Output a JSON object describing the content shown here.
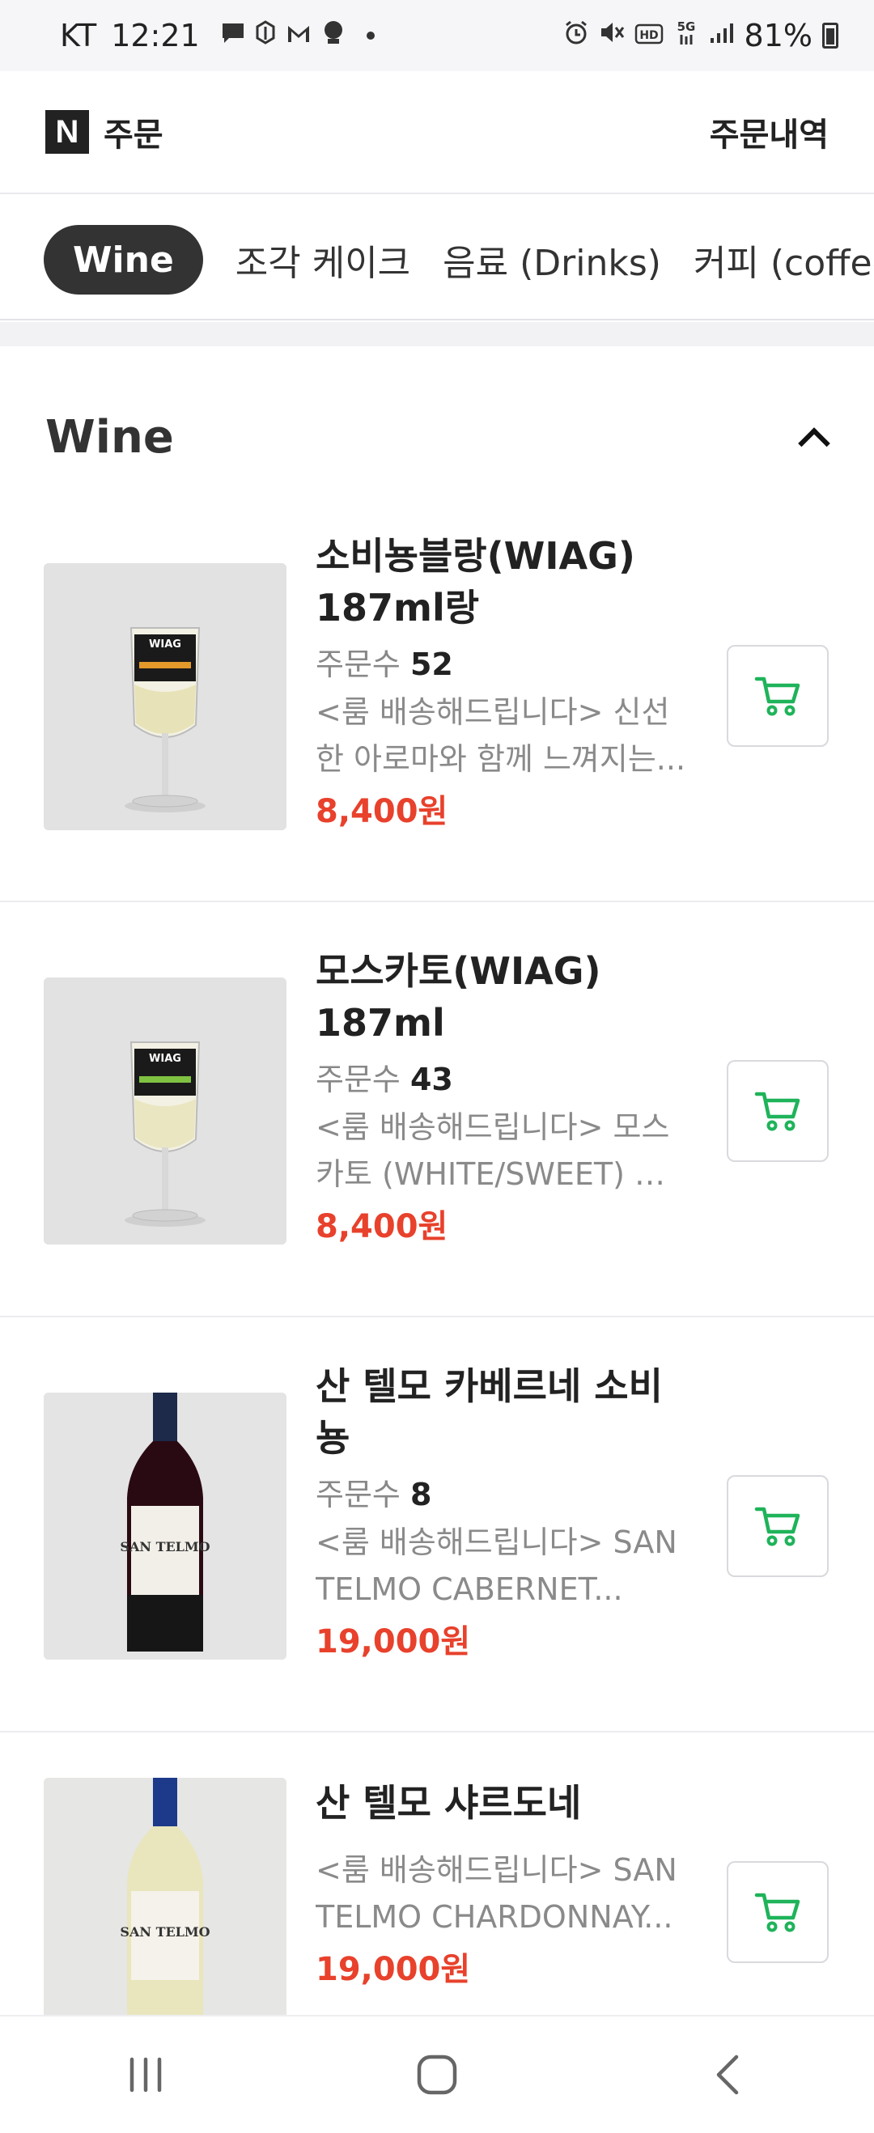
{
  "status_bar": {
    "carrier": "KT",
    "time": "12:21",
    "battery": "81%",
    "left_icons": [
      "message-icon",
      "app-icon",
      "mail-icon",
      "assistant-icon"
    ],
    "right_icons": [
      "alarm-icon",
      "mute-icon",
      "hd-icon",
      "5g-icon",
      "signal-icon"
    ]
  },
  "header": {
    "logo_letter": "N",
    "title": "주문",
    "order_history_label": "주문내역"
  },
  "tabs": [
    {
      "label": "Wine",
      "active": true
    },
    {
      "label": "조각 케이크",
      "active": false
    },
    {
      "label": "음료 (Drinks)",
      "active": false
    },
    {
      "label": "커피 (coffee)",
      "active": false
    }
  ],
  "section": {
    "title": "Wine"
  },
  "products": [
    {
      "name_line1": "소비뇽블랑(WIAG)",
      "name_line2": "187ml랑",
      "orders_label": "주문수",
      "orders_count": "52",
      "desc_line1": "<룸 배송해드립니다> 신선",
      "desc_line2": "한 아로마와 함께 느껴지는...",
      "price": "8,400원"
    },
    {
      "name_line1": "모스카토(WIAG)",
      "name_line2": "187ml",
      "orders_label": "주문수",
      "orders_count": "43",
      "desc_line1": "<룸 배송해드립니다> 모스",
      "desc_line2": "카토 (WHITE/SWEET) 케...",
      "price": "8,400원"
    },
    {
      "name_line1": "산 텔모 카베르네 소비",
      "name_line2": "뇽",
      "orders_label": "주문수",
      "orders_count": "8",
      "desc_line1": "<룸 배송해드립니다> SAN",
      "desc_line2": "TELMO CABERNET...",
      "price": "19,000원"
    },
    {
      "name_line1": "산 텔모 샤르도네",
      "desc_line1": "<룸 배송해드립니다> SAN",
      "desc_line2": "TELMO CHARDONNAY...",
      "price": "19,000원"
    }
  ],
  "colors": {
    "price": "#e8412c",
    "cart_icon": "#1fb35a",
    "active_tab_bg": "#333333"
  }
}
